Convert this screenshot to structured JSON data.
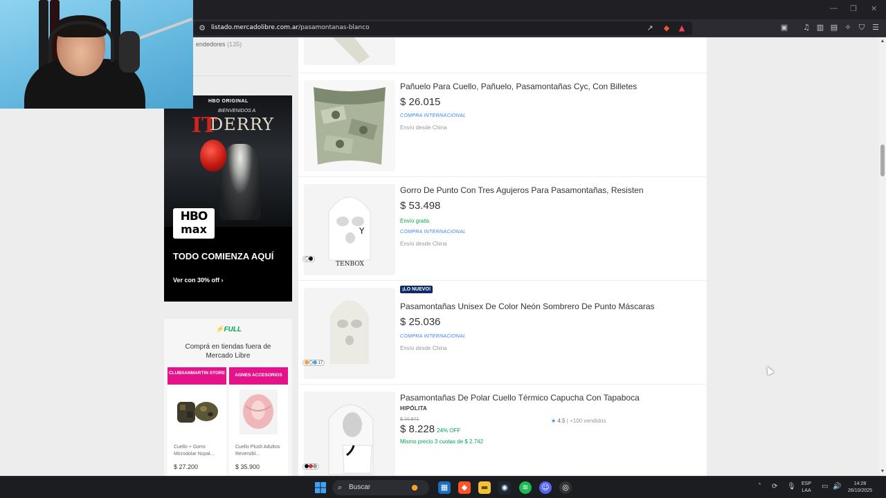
{
  "browser": {
    "url_host": "listado.mercadolibre.com.ar",
    "url_path": "/pasamontanas-blanco",
    "window_controls": [
      "—",
      "❐",
      "✕"
    ]
  },
  "sidebar": {
    "sellers_label": "endedores",
    "sellers_count": "(135)",
    "ad": {
      "brand_top": "HBO ORIGINAL",
      "subtitle": "BIENVENIDOS A",
      "title": "DERRY",
      "logo_line1": "HBO",
      "logo_line2": "max",
      "headline": "TODO COMIENZA AQUÍ",
      "cta": "Ver con 30% off"
    },
    "full_card": {
      "logo": "FULL",
      "text": "Comprá en tiendas fuera de Mercado Libre",
      "stores": [
        {
          "name": "CLUBSANMARTIN STORE",
          "product": "Cuello + Gorro Microdolar Ncpal...",
          "price": "$ 27.200"
        },
        {
          "name": "AGNES ACCESORIOS",
          "product": "Cuello Plush Adultos Reversibl...",
          "price": "$ 35.900"
        }
      ]
    }
  },
  "results": [
    {
      "title": "Pañuelo Para Cuello, Pañuelo, Pasamontañas Cyc, Con Billetes",
      "price": "$ 26.015",
      "intl": "COMPRA INTERNACIONAL",
      "shipping": "Envío desde China"
    },
    {
      "title": "Gorro De Punto Con Tres Agujeros Para Pasamontañas, Resisten",
      "price": "$ 53.498",
      "free_shipping": "Envío gratis",
      "intl": "COMPRA INTERNACIONAL",
      "shipping": "Envío desde China"
    },
    {
      "badge": "¡LO NUEVO!",
      "title": "Pasamontañas Unisex De Color Neón Sombrero De Punto Máscaras",
      "price": "$ 25.036",
      "intl": "COMPRA INTERNACIONAL",
      "shipping": "Envío desde China",
      "swatch_count": "17"
    },
    {
      "title": "Pasamontañas De Polar Cuello Térmico Capucha Con Tapaboca",
      "brand": "HIPÓLITA",
      "old_price": "$ 10.971",
      "price": "$ 8.228",
      "discount": "24% OFF",
      "installments": "Mismo precio 3 cuotas de $ 2.742",
      "rating": "4.5",
      "sold": "+100 vendidos"
    }
  ],
  "taskbar": {
    "search_label": "Buscar",
    "lang_line1": "ESP",
    "lang_line2": "LAA",
    "time": "14:28",
    "date": "26/10/2025"
  }
}
